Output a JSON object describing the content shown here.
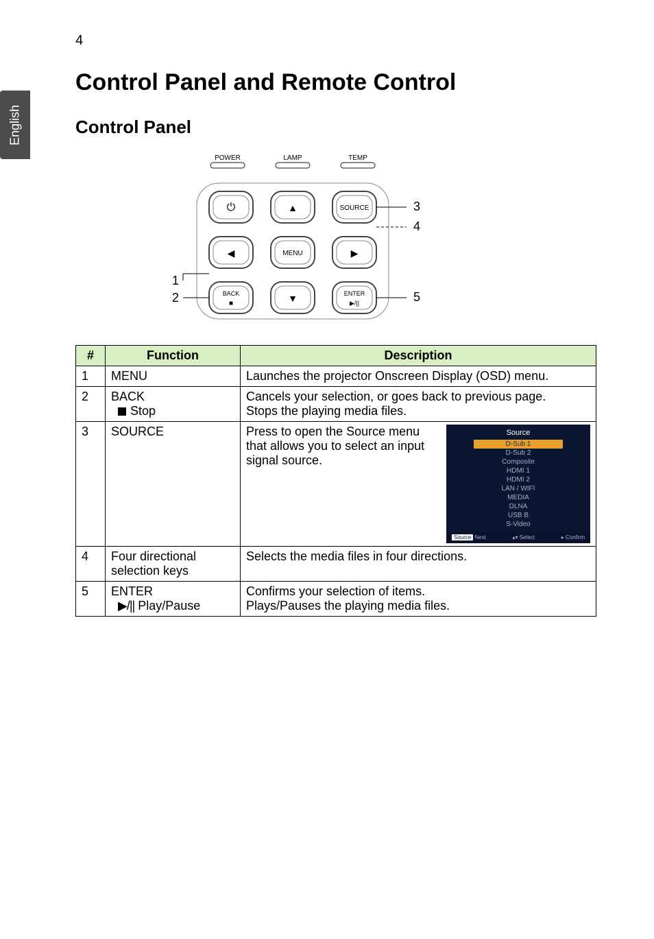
{
  "page_number": "4",
  "sidebar_label": "English",
  "h1": "Control Panel and Remote Control",
  "h2": "Control Panel",
  "panel": {
    "indicators": {
      "power": "POWER",
      "lamp": "LAMP",
      "temp": "TEMP"
    },
    "buttons": {
      "power_icon": "⏻",
      "keystone_icon": "▲",
      "source": "SOURCE",
      "left": "◀",
      "menu": "MENU",
      "right": "▶",
      "back": "BACK",
      "back_icon": "■",
      "down": "▼",
      "enter": "ENTER",
      "enter_icon": "▶/||"
    },
    "callouts": {
      "c1": "1",
      "c2": "2",
      "c3": "3",
      "c4": "4",
      "c5": "5"
    }
  },
  "table": {
    "headers": {
      "num": "#",
      "func": "Function",
      "desc": "Description"
    },
    "rows": [
      {
        "num": "1",
        "func": "MENU",
        "desc": "Launches the projector Onscreen Display (OSD) menu."
      },
      {
        "num": "2",
        "func": "BACK",
        "sub": "Stop",
        "desc_line1": "Cancels your selection, or goes back to previous page.",
        "desc_line2": "Stops the playing media files."
      },
      {
        "num": "3",
        "func": "SOURCE",
        "desc": "Press to open the Source menu that allows you to select an input signal source."
      },
      {
        "num": "4",
        "func": "Four directional selection keys",
        "desc": "Selects the media files in four directions."
      },
      {
        "num": "5",
        "func": "ENTER",
        "sub_glyph": "▶/||",
        "sub": "Play/Pause",
        "desc_line1": "Confirms your selection of items.",
        "desc_line2": "Plays/Pauses the playing media files."
      }
    ]
  },
  "source_menu": {
    "title": "Source",
    "items": [
      "D-Sub 1",
      "D-Sub 2",
      "Composite",
      "HDMI 1",
      "HDMI 2",
      "LAN / WIFI",
      "MEDIA",
      "DLNA",
      "USB B",
      "S-Video"
    ],
    "footer": {
      "left_chip": "Source",
      "left": "Next",
      "mid_icon": "▴▾",
      "mid": "Select",
      "right_icon": "▸",
      "right": "Confirm"
    }
  }
}
